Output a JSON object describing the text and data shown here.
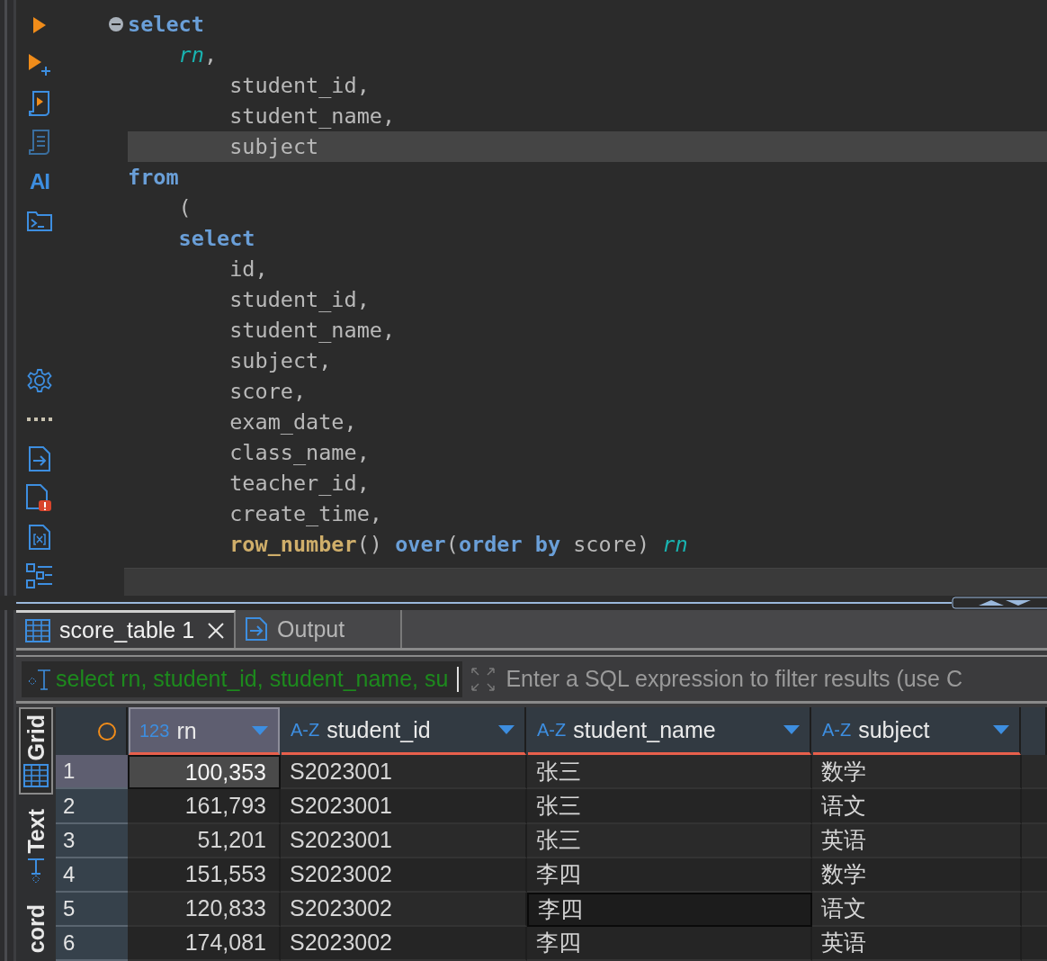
{
  "toolbar": {
    "items": [
      {
        "kind": "run"
      },
      {
        "kind": "run-new"
      },
      {
        "kind": "script-run"
      },
      {
        "kind": "script"
      },
      {
        "kind": "text",
        "label": "AI"
      },
      {
        "kind": "terminal"
      },
      {
        "kind": "gap"
      },
      {
        "kind": "settings"
      },
      {
        "kind": "more"
      },
      {
        "kind": "export"
      },
      {
        "kind": "problems"
      },
      {
        "kind": "variables"
      },
      {
        "kind": "outline"
      }
    ]
  },
  "editor": {
    "lines": [
      {
        "fold": true,
        "current": false,
        "tokens": [
          {
            "kind": "keyword",
            "text": "select"
          }
        ]
      },
      {
        "fold": false,
        "current": false,
        "tokens": [
          {
            "kind": "alias",
            "text": "    rn"
          },
          {
            "kind": "plain",
            "text": ","
          }
        ]
      },
      {
        "fold": false,
        "current": false,
        "tokens": [
          {
            "kind": "plain",
            "text": "        student_id,"
          }
        ]
      },
      {
        "fold": false,
        "current": false,
        "tokens": [
          {
            "kind": "plain",
            "text": "        student_name,"
          }
        ]
      },
      {
        "fold": false,
        "current": true,
        "tokens": [
          {
            "kind": "plain",
            "text": "        subject"
          }
        ]
      },
      {
        "fold": false,
        "current": false,
        "tokens": [
          {
            "kind": "keyword",
            "text": "from"
          }
        ]
      },
      {
        "fold": false,
        "current": false,
        "tokens": [
          {
            "kind": "plain",
            "text": "    ("
          }
        ]
      },
      {
        "fold": false,
        "current": false,
        "tokens": [
          {
            "kind": "keyword",
            "text": "    select"
          }
        ]
      },
      {
        "fold": false,
        "current": false,
        "tokens": [
          {
            "kind": "plain",
            "text": "        id,"
          }
        ]
      },
      {
        "fold": false,
        "current": false,
        "tokens": [
          {
            "kind": "plain",
            "text": "        student_id,"
          }
        ]
      },
      {
        "fold": false,
        "current": false,
        "tokens": [
          {
            "kind": "plain",
            "text": "        student_name,"
          }
        ]
      },
      {
        "fold": false,
        "current": false,
        "tokens": [
          {
            "kind": "plain",
            "text": "        subject,"
          }
        ]
      },
      {
        "fold": false,
        "current": false,
        "tokens": [
          {
            "kind": "plain",
            "text": "        score,"
          }
        ]
      },
      {
        "fold": false,
        "current": false,
        "tokens": [
          {
            "kind": "plain",
            "text": "        exam_date,"
          }
        ]
      },
      {
        "fold": false,
        "current": false,
        "tokens": [
          {
            "kind": "plain",
            "text": "        class_name,"
          }
        ]
      },
      {
        "fold": false,
        "current": false,
        "tokens": [
          {
            "kind": "plain",
            "text": "        teacher_id,"
          }
        ]
      },
      {
        "fold": false,
        "current": false,
        "tokens": [
          {
            "kind": "plain",
            "text": "        create_time,"
          }
        ]
      },
      {
        "fold": false,
        "current": false,
        "tokens": [
          {
            "kind": "function",
            "text": "        row_number"
          },
          {
            "kind": "plain",
            "text": "() "
          },
          {
            "kind": "keyword",
            "text": "over"
          },
          {
            "kind": "plain",
            "text": "("
          },
          {
            "kind": "keyword",
            "text": "order by"
          },
          {
            "kind": "plain",
            "text": " score) "
          },
          {
            "kind": "alias",
            "text": "rn"
          }
        ]
      }
    ]
  },
  "result_tabs": [
    {
      "label": "score_table 1",
      "selected": true,
      "closable": true
    },
    {
      "label": "Output",
      "selected": false,
      "closable": false
    }
  ],
  "filter": {
    "value": "select rn, student_id, student_name, su",
    "placeholder": "Enter a SQL expression to filter results (use C"
  },
  "view_tabs": [
    {
      "label": "Grid",
      "selected": true
    },
    {
      "label": "Text",
      "selected": false
    },
    {
      "label": "cord",
      "selected": false
    }
  ],
  "table": {
    "columns": [
      {
        "type": "123",
        "name": "rn",
        "selected": true
      },
      {
        "type": "A-Z",
        "name": "student_id",
        "selected": false
      },
      {
        "type": "A-Z",
        "name": "student_name",
        "selected": false
      },
      {
        "type": "A-Z",
        "name": "subject",
        "selected": false
      }
    ],
    "rows": [
      {
        "number": "1",
        "selected": true,
        "cells": [
          {
            "value": "100,353",
            "selected": true,
            "focused": false
          },
          {
            "value": "S2023001",
            "selected": false,
            "focused": false
          },
          {
            "value": "张三",
            "selected": false,
            "focused": false
          },
          {
            "value": "数学",
            "selected": false,
            "focused": false
          }
        ]
      },
      {
        "number": "2",
        "selected": false,
        "cells": [
          {
            "value": "161,793",
            "selected": false,
            "focused": false
          },
          {
            "value": "S2023001",
            "selected": false,
            "focused": false
          },
          {
            "value": "张三",
            "selected": false,
            "focused": false
          },
          {
            "value": "语文",
            "selected": false,
            "focused": false
          }
        ]
      },
      {
        "number": "3",
        "selected": false,
        "cells": [
          {
            "value": "51,201",
            "selected": false,
            "focused": false
          },
          {
            "value": "S2023001",
            "selected": false,
            "focused": false
          },
          {
            "value": "张三",
            "selected": false,
            "focused": false
          },
          {
            "value": "英语",
            "selected": false,
            "focused": false
          }
        ]
      },
      {
        "number": "4",
        "selected": false,
        "cells": [
          {
            "value": "151,553",
            "selected": false,
            "focused": false
          },
          {
            "value": "S2023002",
            "selected": false,
            "focused": false
          },
          {
            "value": "李四",
            "selected": false,
            "focused": false
          },
          {
            "value": "数学",
            "selected": false,
            "focused": false
          }
        ]
      },
      {
        "number": "5",
        "selected": false,
        "cells": [
          {
            "value": "120,833",
            "selected": false,
            "focused": false
          },
          {
            "value": "S2023002",
            "selected": false,
            "focused": false
          },
          {
            "value": "李四",
            "selected": false,
            "focused": true
          },
          {
            "value": "语文",
            "selected": false,
            "focused": false
          }
        ]
      },
      {
        "number": "6",
        "selected": false,
        "cells": [
          {
            "value": "174,081",
            "selected": false,
            "focused": false
          },
          {
            "value": "S2023002",
            "selected": false,
            "focused": false
          },
          {
            "value": "李四",
            "selected": false,
            "focused": false
          },
          {
            "value": "英语",
            "selected": false,
            "focused": false
          }
        ]
      }
    ]
  }
}
